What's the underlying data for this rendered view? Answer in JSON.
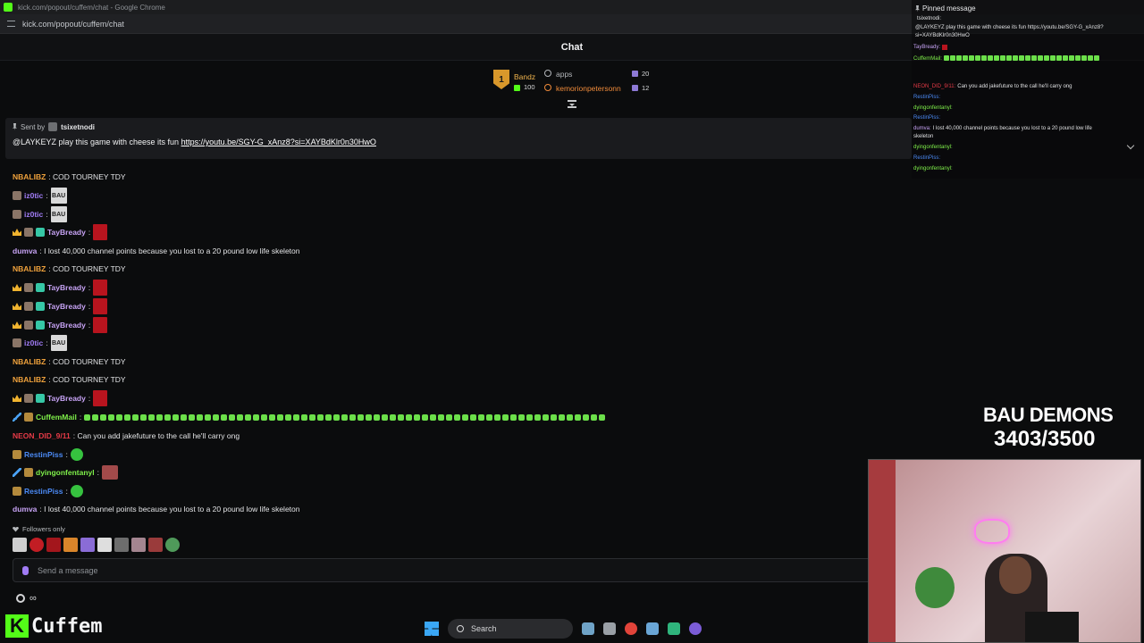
{
  "window": {
    "title": "kick.com/popout/cuffem/chat - Google Chrome",
    "url": "kick.com/popout/cuffem/chat"
  },
  "chat": {
    "title": "Chat"
  },
  "leaderboard": {
    "rank": "1",
    "top_name": "Bandz",
    "top_count": "100",
    "entries": [
      {
        "name": "apps",
        "count": "20"
      },
      {
        "name": "kemorionpetersonn",
        "count": "12"
      }
    ]
  },
  "pinned": {
    "sent_by_label": "Sent by",
    "sender": "tsixetnodi",
    "message": "@LAYKEYZ play this game with cheese its fun ",
    "link": "https://youtu.be/SGY-G_xAnz8?si=XAYBdKlr0n30HwO"
  },
  "messages": [
    {
      "user": "NBALIBZ",
      "text": ": COD TOURNEY TDY"
    },
    {
      "user": "iz0tic",
      "text": ":"
    },
    {
      "user": "iz0tic",
      "text": ":"
    },
    {
      "user": "TayBready",
      "text": ":"
    },
    {
      "user": "dumva",
      "text": ": I lost 40,000 channel points because you lost to a 20 pound low life skeleton"
    },
    {
      "user": "NBALIBZ",
      "text": ": COD TOURNEY TDY"
    },
    {
      "user": "TayBready",
      "text": ":"
    },
    {
      "user": "TayBready",
      "text": ":"
    },
    {
      "user": "TayBready",
      "text": ":"
    },
    {
      "user": "iz0tic",
      "text": ":"
    },
    {
      "user": "NBALIBZ",
      "text": ": COD TOURNEY TDY"
    },
    {
      "user": "NBALIBZ",
      "text": ": COD TOURNEY TDY"
    },
    {
      "user": "TayBready",
      "text": ":"
    },
    {
      "user": "CuffemMail",
      "text": ":"
    },
    {
      "user": "NEON_DID_9/11",
      "text": ": Can you add jakefuture to the call he'll carry ong"
    },
    {
      "user": "RestinPiss",
      "text": ":"
    },
    {
      "user": "dyingonfentanyl",
      "text": ":"
    },
    {
      "user": "RestinPiss",
      "text": ":"
    },
    {
      "user": "dumva",
      "text": ": I lost 40,000 channel points because you lost to a 20 pound low life skeleton"
    }
  ],
  "emote_text": {
    "bau": "BAU"
  },
  "footer": {
    "followers_only": "Followers only",
    "send_placeholder": "Send a message",
    "infinity": "∞"
  },
  "overlay": {
    "pinned_title": "Pinned message",
    "pinned_sender": "tsixetnodi:",
    "pinned_line1": "@LAYKEYZ play this game with cheese its fun https://youtu.be/SGY-G_xAnz8?",
    "pinned_line2": "si=XAYBdKlr0n30HwO",
    "lines": [
      {
        "user": "TayBready:",
        "text": ""
      },
      {
        "user": "CuffemMail:",
        "text": ""
      },
      {
        "user": "NEON_DID_9/11:",
        "text": "Can you add jakefuture to the call he'll carry ong"
      },
      {
        "user": "RestinPiss:",
        "text": ""
      },
      {
        "user": "dyingonfentanyl:",
        "text": ""
      },
      {
        "user": "RestinPiss:",
        "text": ""
      },
      {
        "user": "dumva:",
        "text": "I lost 40,000 channel points because you lost to a 20 pound low life"
      },
      {
        "user": "",
        "text": "skeleton"
      },
      {
        "user": "dyingonfentanyl:",
        "text": ""
      },
      {
        "user": "RestinPiss:",
        "text": ""
      },
      {
        "user": "dyingonfentanyl:",
        "text": ""
      }
    ]
  },
  "goal": {
    "title": "BAU DEMONS",
    "count": "3403/3500"
  },
  "brand": {
    "logo_letter": "K",
    "name": "Cuffem"
  },
  "taskbar": {
    "search_label": "Search"
  },
  "colors": {
    "kick_green": "#53fc18",
    "background": "#0b0c0d",
    "pinned_bg": "#1a1b1e"
  }
}
